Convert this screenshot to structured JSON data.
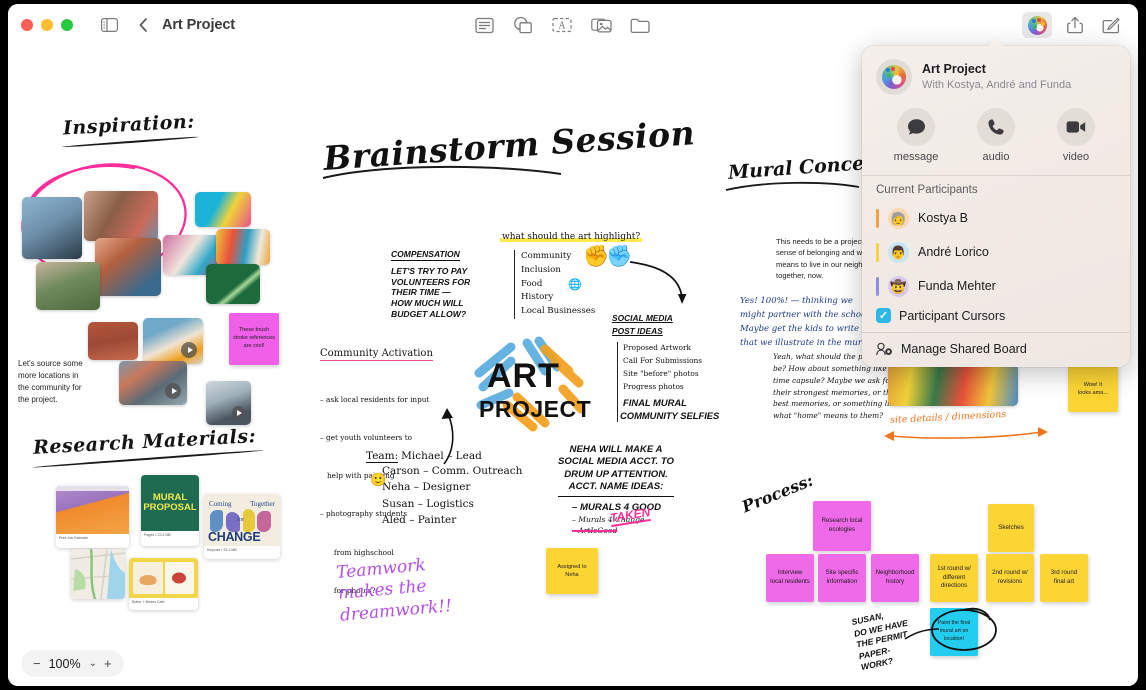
{
  "window": {
    "title": "Art Project",
    "traffic_lights": [
      "close",
      "minimize",
      "zoom"
    ]
  },
  "toolbar": {
    "sidebar_toggle": "sidebar-toggle-icon",
    "back": "back-chevron-icon",
    "center_tools": [
      {
        "name": "sticky-note-tool",
        "label": "Sticky Note"
      },
      {
        "name": "shapes-tool",
        "label": "Shapes"
      },
      {
        "name": "text-box-tool",
        "label": "Text Box"
      },
      {
        "name": "media-tool",
        "label": "Media"
      },
      {
        "name": "file-tool",
        "label": "Insert File"
      }
    ],
    "right_tools": [
      {
        "name": "collaboration-button",
        "label": "Collaborate"
      },
      {
        "name": "share-button",
        "label": "Share"
      },
      {
        "name": "markup-button",
        "label": "Markup"
      }
    ]
  },
  "popover": {
    "title": "Art Project",
    "subtitle": "With Kostya, André and Funda",
    "actions": [
      {
        "icon": "message-icon",
        "label": "message"
      },
      {
        "icon": "phone-icon",
        "label": "audio"
      },
      {
        "icon": "video-icon",
        "label": "video"
      }
    ],
    "participants_heading": "Current Participants",
    "participants": [
      {
        "name": "Kostya B",
        "cursor_color": "#F5A04A",
        "avatar_bg": "#FAD9B0",
        "avatar": "🧓"
      },
      {
        "name": "André Lorico",
        "cursor_color": "#F5D14A",
        "avatar_bg": "#C7E6F5",
        "avatar": "👨"
      },
      {
        "name": "Funda Mehter",
        "cursor_color": "#8A8FE0",
        "avatar_bg": "#D7CCEF",
        "avatar": "🤠"
      }
    ],
    "participant_cursors": {
      "label": "Participant Cursors",
      "checked": true,
      "color": "#2EB8E8"
    },
    "manage": {
      "label": "Manage Shared Board",
      "icon": "manage-board-icon"
    }
  },
  "zoom_control": {
    "minus": "−",
    "value": "100%",
    "chevron": "⌄",
    "plus": "+"
  },
  "canvas": {
    "headings": {
      "inspiration": "Inspiration:",
      "research": "Research Materials:",
      "brainstorm": "Brainstorm Session",
      "mural": "Mural Concepts",
      "process": "Process:"
    },
    "inspiration_note": "These brush\nstroke references\nare cool!",
    "inspiration_text": "Let's source some\nmore locations in\nthe community for\nthe project.",
    "compensation": {
      "title": "COMPENSATION",
      "body": "LET'S TRY TO PAY\nVOLUNTEERS FOR\nTHEIR TIME —\nHOW MUCH WILL\nBUDGET ALLOW?"
    },
    "art_highlight": {
      "question": "what should the art highlight?",
      "items": [
        "Community",
        "Inclusion",
        "Food",
        "History",
        "Local Businesses"
      ]
    },
    "social_media": {
      "title": "SOCIAL MEDIA\nPOST IDEAS",
      "items": [
        "Proposed Artwork",
        "Call For Submissions",
        "Site \"before\" photos",
        "Progress photos"
      ],
      "bold_items": [
        "FINAL MURAL",
        "COMMUNITY SELFIES"
      ]
    },
    "community_activation": {
      "title": "Community Activation",
      "items": [
        "– ask local residents for input",
        "– get youth volunteers to",
        "   help with painting",
        "– photography students",
        "      from highschool",
        "      for photos?"
      ]
    },
    "team": {
      "label": "Team:",
      "members": [
        "Michael – Lead",
        "Carson – Comm. Outreach",
        "Neha – Designer",
        "Susan – Logistics",
        "Aled – Painter"
      ]
    },
    "neha_note": {
      "body": "NEHA WILL MAKE A\nSOCIAL MEDIA ACCT. TO\nDRUM UP ATTENTION.\nACCT. NAME IDEAS:",
      "ideas": [
        "– MURALS 4 GOOD",
        "– Murals 4 Change",
        "– ArtIsGood"
      ],
      "taken": "TAKEN"
    },
    "assigned_note": "Assigned to\nNeha",
    "teamwork": "Teamwork\nmakes the\ndreamwork!!",
    "art_logo": {
      "line1": "ART",
      "line2": "PROJECT"
    },
    "mural_intro": "This needs to be a project about a\nsense of belonging and what it\nmeans to live in our neighborhood\ntogether, now.",
    "mural_reply_1": "Yes! 100%! — thinking we\nmight partner with the school.\nMaybe get the kids to write a story\nthat we illustrate in the mural.",
    "mural_reply_2": "Yeah, what should the prompt\nbe? How about something like a\ntime capsule? Maybe we ask for\ntheir strongest memories, or their\nbest memories, or something like\nwhat \"home\" means to them?",
    "site_details": "site details / dimensions",
    "wow_note": "Wow! It\nlooks ama...",
    "process_notes_pink": [
      "Research local\necologies",
      "Interview\nlocal residents",
      "Site specific\ninformation",
      "Neighborhood\nhistory"
    ],
    "process_notes_yellow": [
      "Sketches",
      "1st round w/\ndifferent\ndirections",
      "2nd round w/\nrevisions",
      "3rd round\nfinal art"
    ],
    "cyan_note": "Paint the final\nmural art on\nlocation!",
    "susan_note": "SUSAN,\nDO WE HAVE\nTHE PERMIT\nPAPER-\nWORK?",
    "research_docs": [
      {
        "title": "Print Job Estimate",
        "meta": "printestimates.com"
      },
      {
        "title": "Mural Proposal",
        "meta": "Pages • 23.4 MB",
        "display": "MURAL\nPROPOSAL"
      },
      {
        "title": "Coming Together for Change",
        "meta": "Keynote • 52.1 MB",
        "display": "Coming Together for CHANGE"
      },
      {
        "title": "Map",
        "meta": ""
      },
      {
        "title": "Butter + Beans Cafe",
        "meta": "yourlocalbakeshop.com"
      }
    ]
  }
}
